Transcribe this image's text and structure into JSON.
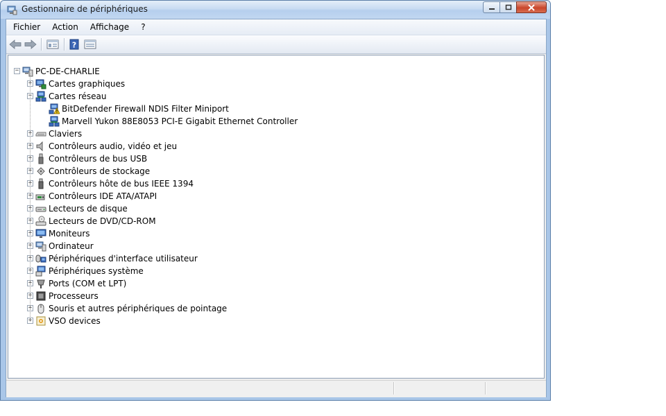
{
  "window": {
    "title": "Gestionnaire de périphériques",
    "icon": "device-manager-icon"
  },
  "menu": [
    {
      "label": "Fichier"
    },
    {
      "label": "Action"
    },
    {
      "label": "Affichage"
    },
    {
      "label": "?"
    }
  ],
  "toolbar": {
    "buttons": [
      "back-arrow-icon",
      "forward-arrow-icon",
      "properties-view-icon",
      "help-icon",
      "update-driver-icon"
    ]
  },
  "tree": {
    "root": {
      "label": "PC-DE-CHARLIE",
      "icon": "computer-icon"
    },
    "items": [
      {
        "label": "Cartes graphiques",
        "icon": "display-adapter-icon",
        "expanded": false
      },
      {
        "label": "Cartes réseau",
        "icon": "network-adapter-icon",
        "expanded": true,
        "children": [
          {
            "label": "BitDefender Firewall NDIS Filter Miniport",
            "icon": "network-warning-icon"
          },
          {
            "label": "Marvell Yukon 88E8053 PCI-E Gigabit Ethernet Controller",
            "icon": "network-adapter-icon"
          }
        ]
      },
      {
        "label": "Claviers",
        "icon": "keyboard-icon",
        "expanded": false
      },
      {
        "label": "Contrôleurs audio, vidéo et jeu",
        "icon": "speaker-icon",
        "expanded": false
      },
      {
        "label": "Contrôleurs de bus USB",
        "icon": "usb-icon",
        "expanded": false
      },
      {
        "label": "Contrôleurs de stockage",
        "icon": "storage-controller-icon",
        "expanded": false
      },
      {
        "label": "Contrôleurs hôte de bus IEEE 1394",
        "icon": "firewire-icon",
        "expanded": false
      },
      {
        "label": "Contrôleurs IDE ATA/ATAPI",
        "icon": "ide-controller-icon",
        "expanded": false
      },
      {
        "label": "Lecteurs de disque",
        "icon": "disk-drive-icon",
        "expanded": false
      },
      {
        "label": "Lecteurs de DVD/CD-ROM",
        "icon": "dvd-drive-icon",
        "expanded": false
      },
      {
        "label": "Moniteurs",
        "icon": "monitor-icon",
        "expanded": false
      },
      {
        "label": "Ordinateur",
        "icon": "computer-icon",
        "expanded": false
      },
      {
        "label": "Périphériques d'interface utilisateur",
        "icon": "hid-icon",
        "expanded": false
      },
      {
        "label": "Périphériques système",
        "icon": "system-device-icon",
        "expanded": false
      },
      {
        "label": "Ports (COM et LPT)",
        "icon": "port-icon",
        "expanded": false
      },
      {
        "label": "Processeurs",
        "icon": "processor-icon",
        "expanded": false
      },
      {
        "label": "Souris et autres périphériques de pointage",
        "icon": "mouse-icon",
        "expanded": false
      },
      {
        "label": "VSO devices",
        "icon": "vso-device-icon",
        "expanded": false
      }
    ]
  },
  "colors": {
    "frame": "#a9c6e8",
    "close_button": "#c9462c"
  }
}
